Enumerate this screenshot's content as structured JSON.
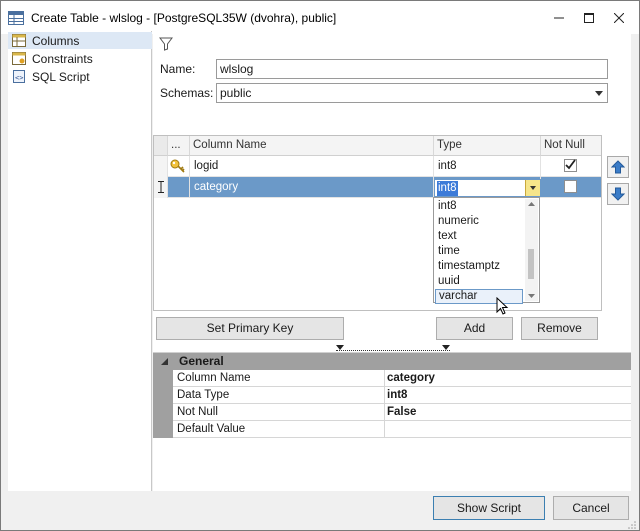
{
  "window": {
    "title": "Create Table - wlslog - [PostgreSQL35W (dvohra), public]"
  },
  "nav": {
    "items": [
      {
        "label": "Columns",
        "icon": "columns-icon"
      },
      {
        "label": "Constraints",
        "icon": "constraints-icon"
      },
      {
        "label": "SQL Script",
        "icon": "sql-script-icon"
      }
    ]
  },
  "form": {
    "name_label": "Name:",
    "name_value": "wlslog",
    "schemas_label": "Schemas:",
    "schemas_value": "public"
  },
  "grid": {
    "headers": {
      "indicator": "...",
      "column_name": "Column Name",
      "type": "Type",
      "not_null": "Not Null"
    },
    "rows": [
      {
        "column_name": "logid",
        "type": "int8",
        "not_null": true,
        "is_key": true
      },
      {
        "column_name": "category",
        "type": "int8",
        "not_null": false,
        "is_key": false,
        "editing": true
      }
    ],
    "type_options": [
      "int8",
      "numeric",
      "text",
      "time",
      "timestamptz",
      "uuid",
      "varchar"
    ],
    "type_hover": "varchar"
  },
  "buttons": {
    "set_primary_key": "Set Primary Key",
    "add": "Add",
    "remove": "Remove",
    "show_script": "Show Script",
    "cancel": "Cancel"
  },
  "properties": {
    "category": "General",
    "rows": [
      {
        "name": "Column Name",
        "value": "category"
      },
      {
        "name": "Data Type",
        "value": "int8"
      },
      {
        "name": "Not Null",
        "value": "False"
      },
      {
        "name": "Default Value",
        "value": ""
      }
    ]
  },
  "colors": {
    "selection": "#6b99c8",
    "editor_highlight": "#3d7bd8",
    "property_header": "#a0a0a0"
  }
}
